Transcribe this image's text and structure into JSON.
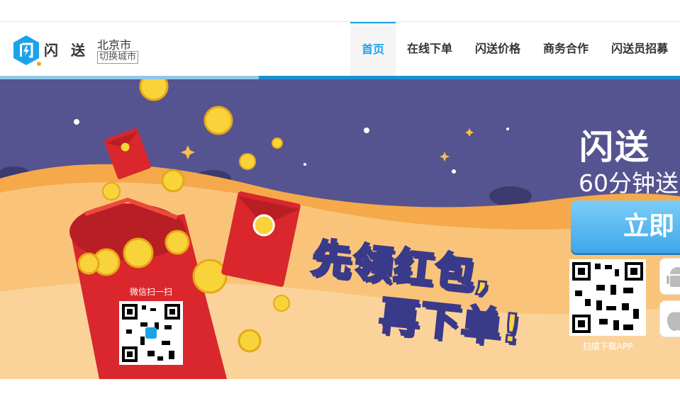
{
  "header": {
    "logo_text": "闪送",
    "city": "北京市",
    "switch_city": "切换城市"
  },
  "nav": {
    "items": [
      {
        "label": "首页",
        "active": true
      },
      {
        "label": "在线下单"
      },
      {
        "label": "闪送价格"
      },
      {
        "label": "商务合作"
      },
      {
        "label": "闪送员招募"
      }
    ]
  },
  "banner": {
    "headline_line1": "先领红包,",
    "headline_line2": "再下单!",
    "wechat_scan_label": "微信扫一扫",
    "brand_title": "闪送",
    "brand_subtitle": "60分钟送",
    "cta_label": "立即",
    "app_scan_label": "扫描下载APP",
    "colors": {
      "sky": "#565490",
      "sand": "#f9c47a",
      "envelope": "#d9272d",
      "coin": "#f9d33a",
      "brand_blue": "#1aa3e8"
    },
    "icons": [
      "android-icon",
      "apple-icon",
      "red-envelope-icon",
      "coin-icon"
    ]
  }
}
